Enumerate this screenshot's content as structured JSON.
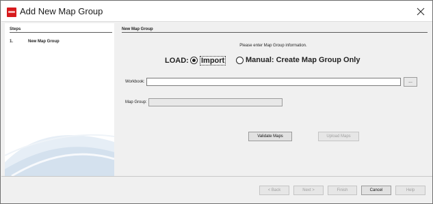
{
  "window": {
    "title": "Add New Map Group"
  },
  "steps": {
    "header": "Steps",
    "items": [
      {
        "number": "1.",
        "label": "New Map Group"
      }
    ]
  },
  "panel": {
    "section_title": "New Map Group",
    "instructions": "Please enter Map Group information.",
    "load_label": "LOAD:",
    "options": [
      {
        "label": "Import",
        "checked": true
      },
      {
        "label": "Manual: Create Map Group Only",
        "checked": false
      }
    ],
    "workbook": {
      "label": "Workbook:",
      "value": "",
      "browse_label": "..."
    },
    "map_group": {
      "label": "Map Group:",
      "value": ""
    },
    "validate_label": "Validate Maps",
    "upload_label": "Upload Maps"
  },
  "footer": {
    "back": "< Back",
    "next": "Next >",
    "finish": "Finish",
    "cancel": "Cancel",
    "help": "Help"
  },
  "colors": {
    "app_icon": "#d7191c",
    "window_bg": "#f0f0f0",
    "panel_bg": "#ffffff"
  },
  "icons": {
    "app": "app-logo-icon",
    "close": "close-icon",
    "decor": "swoosh-graphic"
  }
}
